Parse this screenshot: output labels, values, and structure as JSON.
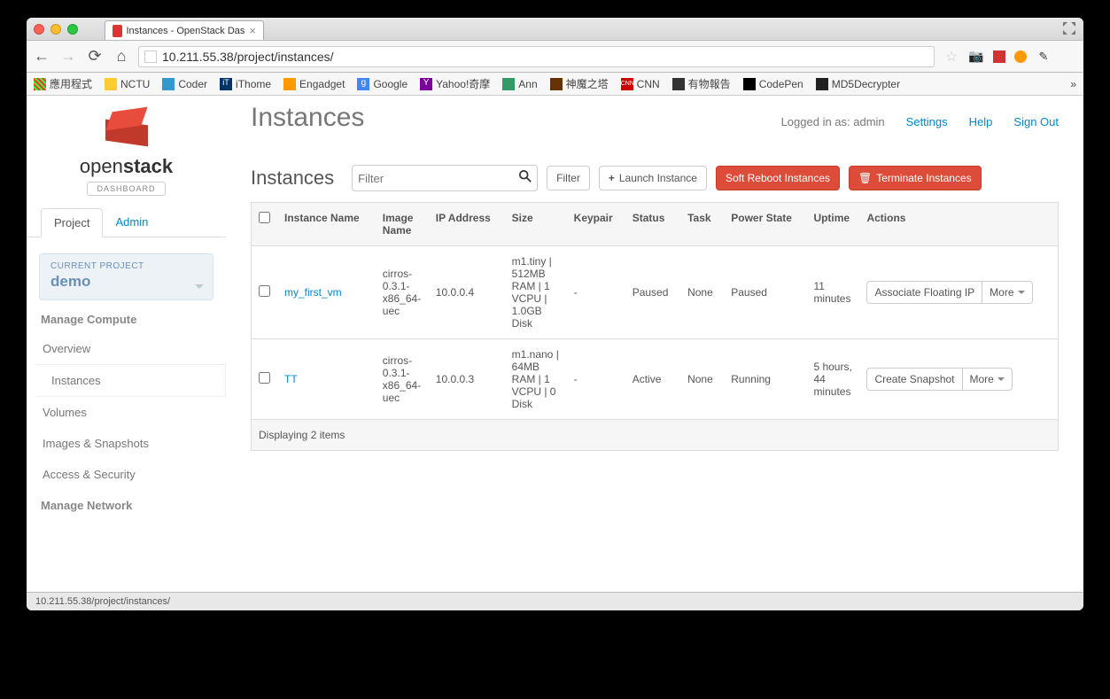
{
  "browser": {
    "tab_title": "Instances - OpenStack Das",
    "url": "10.211.55.38/project/instances/",
    "bookmarks": [
      "應用程式",
      "NCTU",
      "Coder",
      "iThome",
      "Engadget",
      "Google",
      "Yahoo!奇摩",
      "Ann",
      "神魔之塔",
      "CNN",
      "有物報告",
      "CodePen",
      "MD5Decrypter"
    ],
    "status_text": "10.211.55.38/project/instances/"
  },
  "brand": {
    "open": "open",
    "stack": "stack",
    "sub": "DASHBOARD"
  },
  "nav_tabs": {
    "project": "Project",
    "admin": "Admin"
  },
  "project_box": {
    "label": "CURRENT PROJECT",
    "name": "demo"
  },
  "nav_sections": {
    "compute_label": "Manage Compute",
    "compute_items": [
      "Overview",
      "Instances",
      "Volumes",
      "Images & Snapshots",
      "Access & Security"
    ],
    "network_label": "Manage Network"
  },
  "header": {
    "title": "Instances",
    "logged_in": "Logged in as: admin",
    "settings": "Settings",
    "help": "Help",
    "sign_out": "Sign Out"
  },
  "section": {
    "title": "Instances",
    "filter_placeholder": "Filter",
    "filter_btn": "Filter",
    "launch_btn": "Launch Instance",
    "soft_reboot_btn": "Soft Reboot Instances",
    "terminate_btn": "Terminate Instances"
  },
  "table": {
    "headers": [
      "",
      "Instance Name",
      "Image Name",
      "IP Address",
      "Size",
      "Keypair",
      "Status",
      "Task",
      "Power State",
      "Uptime",
      "Actions"
    ],
    "rows": [
      {
        "name": "my_first_vm",
        "image": "cirros-0.3.1-x86_64-uec",
        "ip": "10.0.0.4",
        "size": "m1.tiny | 512MB RAM | 1 VCPU | 1.0GB Disk",
        "keypair": "-",
        "status": "Paused",
        "task": "None",
        "power": "Paused",
        "uptime": "11 minutes",
        "action_main": "Associate Floating IP",
        "action_more": "More"
      },
      {
        "name": "TT",
        "image": "cirros-0.3.1-x86_64-uec",
        "ip": "10.0.0.3",
        "size": "m1.nano | 64MB RAM | 1 VCPU | 0 Disk",
        "keypair": "-",
        "status": "Active",
        "task": "None",
        "power": "Running",
        "uptime": "5 hours, 44 minutes",
        "action_main": "Create Snapshot",
        "action_more": "More"
      }
    ],
    "footer": "Displaying 2 items"
  }
}
